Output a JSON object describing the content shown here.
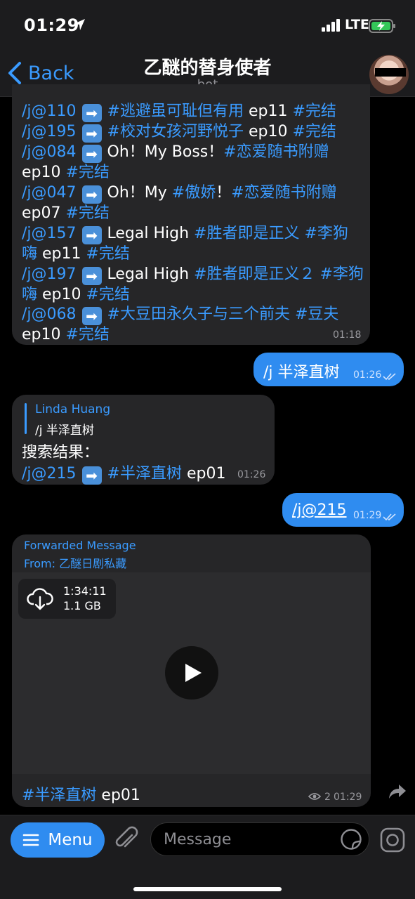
{
  "status": {
    "time": "01:29",
    "network": "LTE"
  },
  "header": {
    "back_label": "Back",
    "title": "乙醚的替身使者",
    "subtitle": "bot"
  },
  "list_message": {
    "lines": [
      {
        "id": "/j@110",
        "rest": [
          {
            "t": "#逃避虽可耻但有用",
            "h": true
          },
          {
            "t": " ep11 ",
            "h": false
          },
          {
            "t": "#完结",
            "h": true
          }
        ]
      },
      {
        "id": "/j@195",
        "rest": [
          {
            "t": "#校对女孩河野悦子",
            "h": true
          },
          {
            "t": " ep10 ",
            "h": false
          },
          {
            "t": "#完结",
            "h": true
          }
        ]
      },
      {
        "id": "/j@084",
        "rest": [
          {
            "t": "Oh！My Boss！",
            "h": false
          },
          {
            "t": "#恋爱随书附赠",
            "h": true
          }
        ]
      },
      {
        "id": "",
        "rest": [
          {
            "t": "ep10 ",
            "h": false
          },
          {
            "t": "#完结",
            "h": true
          }
        ]
      },
      {
        "id": "/j@047",
        "rest": [
          {
            "t": "Oh！My ",
            "h": false
          },
          {
            "t": "#傲娇",
            "h": true
          },
          {
            "t": "！",
            "h": false
          },
          {
            "t": "#恋爱随书附赠",
            "h": true
          }
        ]
      },
      {
        "id": "",
        "rest": [
          {
            "t": "ep07 ",
            "h": false
          },
          {
            "t": "#完结",
            "h": true
          }
        ]
      },
      {
        "id": "/j@157",
        "rest": [
          {
            "t": "Legal High ",
            "h": false
          },
          {
            "t": "#胜者即是正义",
            "h": true
          },
          {
            "t": " ",
            "h": false
          },
          {
            "t": "#李狗",
            "h": true
          }
        ]
      },
      {
        "id": "",
        "rest": [
          {
            "t": "嗨",
            "h": true
          },
          {
            "t": " ep11 ",
            "h": false
          },
          {
            "t": "#完结",
            "h": true
          }
        ]
      },
      {
        "id": "/j@197",
        "rest": [
          {
            "t": "Legal High ",
            "h": false
          },
          {
            "t": "#胜者即是正义２",
            "h": true
          },
          {
            "t": " ",
            "h": false
          },
          {
            "t": "#李狗",
            "h": true
          }
        ]
      },
      {
        "id": "",
        "rest": [
          {
            "t": "嗨",
            "h": true
          },
          {
            "t": " ep10 ",
            "h": false
          },
          {
            "t": "#完结",
            "h": true
          }
        ]
      },
      {
        "id": "/j@068",
        "rest": [
          {
            "t": "#大豆田永久子与三个前夫",
            "h": true
          },
          {
            "t": " ",
            "h": false
          },
          {
            "t": "#豆夫",
            "h": true
          }
        ]
      },
      {
        "id": "",
        "rest": [
          {
            "t": "ep10 ",
            "h": false
          },
          {
            "t": "#完结",
            "h": true
          }
        ]
      }
    ],
    "arrow": "➡",
    "time": "01:18"
  },
  "out_message_1": {
    "text": "/j 半泽直树",
    "time": "01:26"
  },
  "reply_message": {
    "quote_author": "Linda Huang",
    "quote_text": "/j 半泽直树",
    "heading": "搜索结果：",
    "result_id": "/j@215",
    "result_tag": "#半泽直树",
    "result_ep": " ep01",
    "time": "01:26"
  },
  "out_message_2": {
    "text": "/j@215",
    "time": "01:29"
  },
  "forwarded": {
    "label": "Forwarded Message",
    "from_prefix": "From: ",
    "from_name": "乙醚日剧私藏",
    "duration": "1:34:11",
    "size": "1.1 GB",
    "caption_tag": "#半泽直树",
    "caption_rest": " ep01",
    "views": "2",
    "time": "01:29"
  },
  "input": {
    "menu_label": "Menu",
    "placeholder": "Message"
  }
}
